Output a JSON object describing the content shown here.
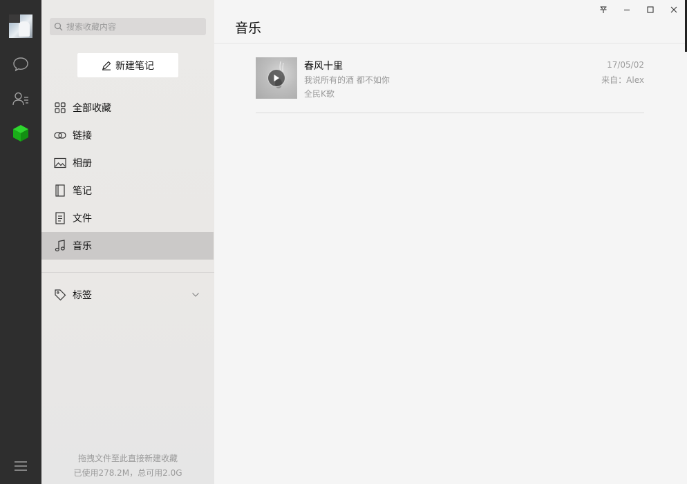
{
  "app": {
    "title": "微信收藏",
    "accent_color": "#1aad19"
  },
  "rail": {
    "items": [
      {
        "icon": "chat-icon"
      },
      {
        "icon": "contacts-icon"
      },
      {
        "icon": "favorites-cube-icon",
        "active": true
      }
    ],
    "menu_icon": "hamburger-menu-icon"
  },
  "sidebar": {
    "search_placeholder": "搜索收藏内容",
    "new_note_label": "新建笔记",
    "items": [
      {
        "label": "全部收藏",
        "icon": "grid-icon"
      },
      {
        "label": "链接",
        "icon": "link-icon"
      },
      {
        "label": "相册",
        "icon": "image-icon"
      },
      {
        "label": "笔记",
        "icon": "notebook-icon"
      },
      {
        "label": "文件",
        "icon": "file-icon"
      },
      {
        "label": "音乐",
        "icon": "music-note-icon",
        "active": true
      }
    ],
    "tags_label": "标签",
    "footer_line1": "拖拽文件至此直接新建收藏",
    "footer_line2": "已使用278.2M，总可用2.0G"
  },
  "main": {
    "title": "音乐",
    "items": [
      {
        "title": "春风十里",
        "subtitle": "我说所有的酒 都不如你",
        "source": "全民K歌",
        "date": "17/05/02",
        "from": "来自：Alex"
      }
    ]
  },
  "window_controls": {
    "pin": "pin-icon",
    "minimize": "minimize-icon",
    "maximize": "maximize-icon",
    "close": "close-icon"
  }
}
